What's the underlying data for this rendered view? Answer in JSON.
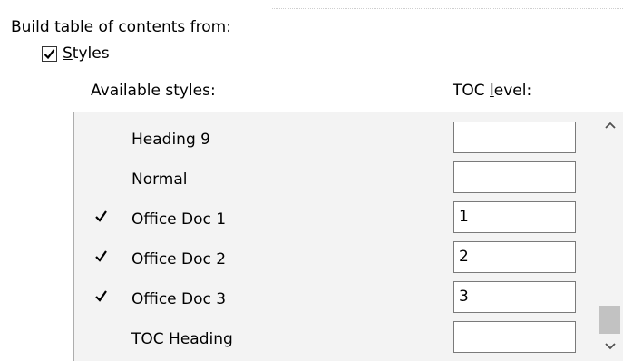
{
  "section": {
    "title": "Build table of contents from:"
  },
  "styles_option": {
    "checked": true,
    "label_first": "S",
    "label_rest": "tyles"
  },
  "columns": {
    "available_styles": "Available styles:",
    "toc_level_pre": "TOC ",
    "toc_level_ul": "l",
    "toc_level_post": "evel:"
  },
  "rows": [
    {
      "name": "Heading 9",
      "checked": false,
      "level": ""
    },
    {
      "name": "Normal",
      "checked": false,
      "level": ""
    },
    {
      "name": "Office Doc 1",
      "checked": true,
      "level": "1"
    },
    {
      "name": "Office Doc 2",
      "checked": true,
      "level": "2"
    },
    {
      "name": "Office Doc 3",
      "checked": true,
      "level": "3"
    },
    {
      "name": "TOC Heading",
      "checked": false,
      "level": ""
    }
  ],
  "scroll": {
    "up_icon": "chevron-up-icon",
    "down_icon": "chevron-down-icon"
  }
}
